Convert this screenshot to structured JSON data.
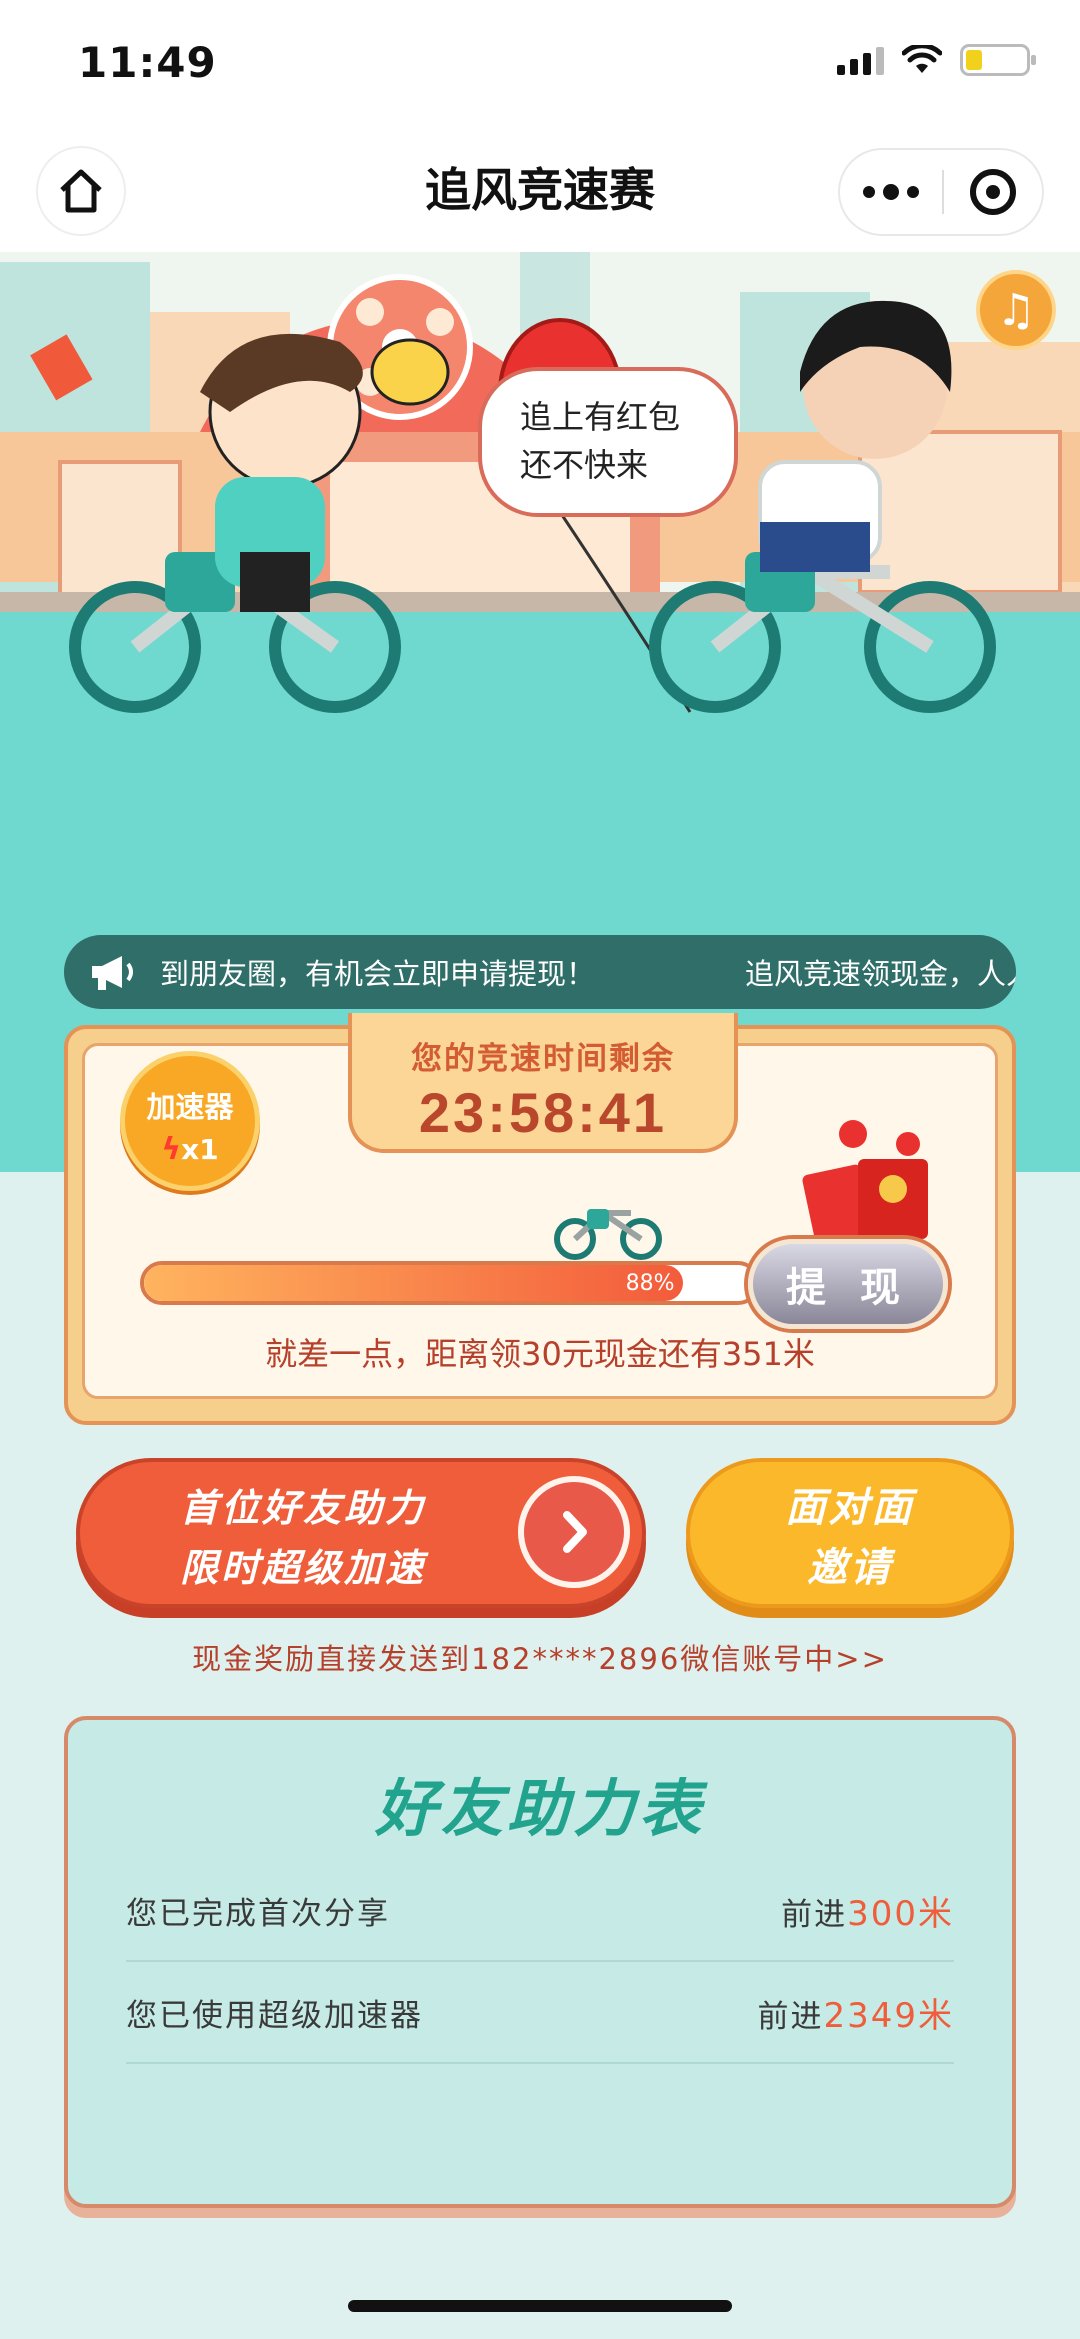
{
  "status": {
    "time": "11:49"
  },
  "nav": {
    "title": "追风竞速赛"
  },
  "hero": {
    "speech_line1": "追上有红包",
    "speech_line2": "还不快来",
    "music_icon": "music-note-icon"
  },
  "ticker": {
    "text1": "到朋友圈，有机会立即申请提现！",
    "text2": "追风竞速领现金，人人有"
  },
  "progress": {
    "timer_label": "您的竞速时间剩余",
    "timer_value": "23:58:41",
    "booster_label": "加速器",
    "booster_count": "x1",
    "percent_text": "88%",
    "percent": 88,
    "withdraw_label": "提 现",
    "gap_text": "就差一点，距离领30元现金还有351米"
  },
  "actions": {
    "boost_line1": "首位好友助力",
    "boost_line2": "限时超级加速",
    "face_line1": "面对面",
    "face_line2": "邀请"
  },
  "cash_link": "现金奖励直接发送到182****2896微信账号中>>",
  "friends": {
    "title": "好友助力表",
    "rows": [
      {
        "label": "您已完成首次分享",
        "prefix": "前进",
        "value": "300米"
      },
      {
        "label": "您已使用超级加速器",
        "prefix": "前进",
        "value": "2349米"
      }
    ]
  },
  "colors": {
    "accent": "#ef5d3a",
    "teal": "#21a38e",
    "orange": "#fbb82a"
  }
}
